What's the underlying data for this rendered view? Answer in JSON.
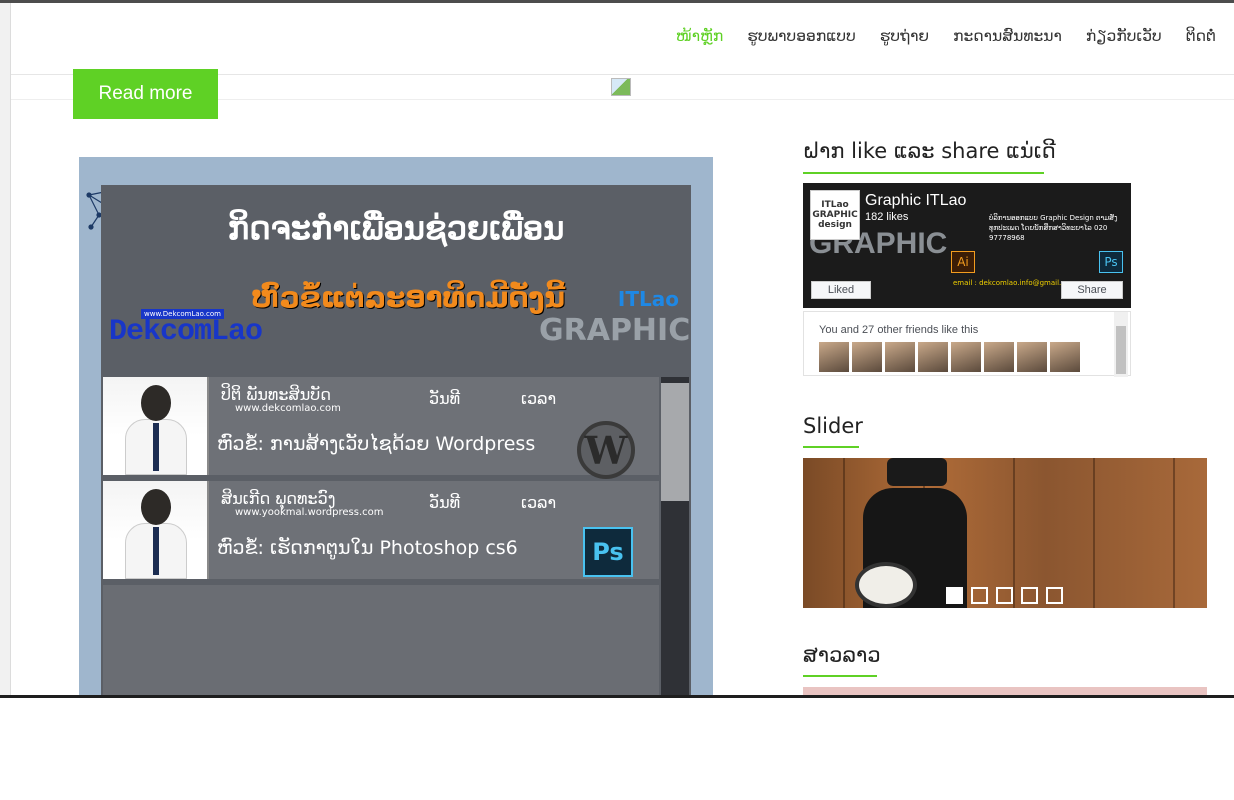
{
  "nav": {
    "items": [
      {
        "label": "ໜ້າຫຼັກ",
        "active": true
      },
      {
        "label": "ຮູບພາບອອກແບບ",
        "active": false
      },
      {
        "label": "ຮູບຖ່າຍ",
        "active": false
      },
      {
        "label": "ກະດານສົນທະນາ",
        "active": false
      },
      {
        "label": "ກ່ຽວກັບເວັບ",
        "active": false
      },
      {
        "label": "ຕິດຕໍ່",
        "active": false
      }
    ]
  },
  "read_more": "Read more",
  "poster": {
    "title": "ກິດຈະກຳເພື່ອນຊ່ວຍເພື່ອນ",
    "subtitle": "ຫົວຂໍ້ແຕ່ລະອາທິດມີດັ່ງນີ້",
    "dek_logo": "DekcomLao",
    "dek_logo_small": "www.DekcomLao.com",
    "gfx_itlao": "ITLao",
    "gfx_word": "GRAPHIC",
    "rows": [
      {
        "name": "ປິຕິ ພັນທະສິນບັດ",
        "site": "www.dekcomlao.com",
        "day": "ວັນທີ",
        "time": "ເວລາ",
        "topic": "ຫົວຂໍ້: ການສ້າງເວັບໄຊດ້ວຍ Wordpress",
        "icon_label": "W"
      },
      {
        "name": "ສິນເກີດ ພຸດທະວົງ",
        "site": "www.yookmal.wordpress.com",
        "day": "ວັນທີ",
        "time": "ເວລາ",
        "topic": "ຫົວຂໍ້: ເຮັດກາຕູນໃນ Photoshop cs6",
        "icon_label": "Ps"
      }
    ]
  },
  "sidebar": {
    "like_heading": "ຝາກ like ແລະ share ແນ່ເດີ",
    "fb": {
      "avatar_text": "ITLao GRAPHIC design",
      "page_name": "Graphic ITLao",
      "likes": "182 likes",
      "graphic_word": "GRAPHIC",
      "info": "ບໍລິການອອກແບບ Graphic Design ຕາມສັ່ງ ທຸກປະເພດ ໂດຍນັກສຶກສາວິທະຍາໄລ 020 97778968",
      "email": "email : dekcomlao.info@gmail.com",
      "ai_label": "Ai",
      "ps_label": "Ps",
      "liked_label": "Liked",
      "share_label": "Share",
      "friends_text": "You and 27 other friends like this"
    },
    "slider_heading": "Slider",
    "slider_dots": [
      true,
      false,
      false,
      false,
      false
    ],
    "lao_heading": "ສາວລາວ"
  }
}
